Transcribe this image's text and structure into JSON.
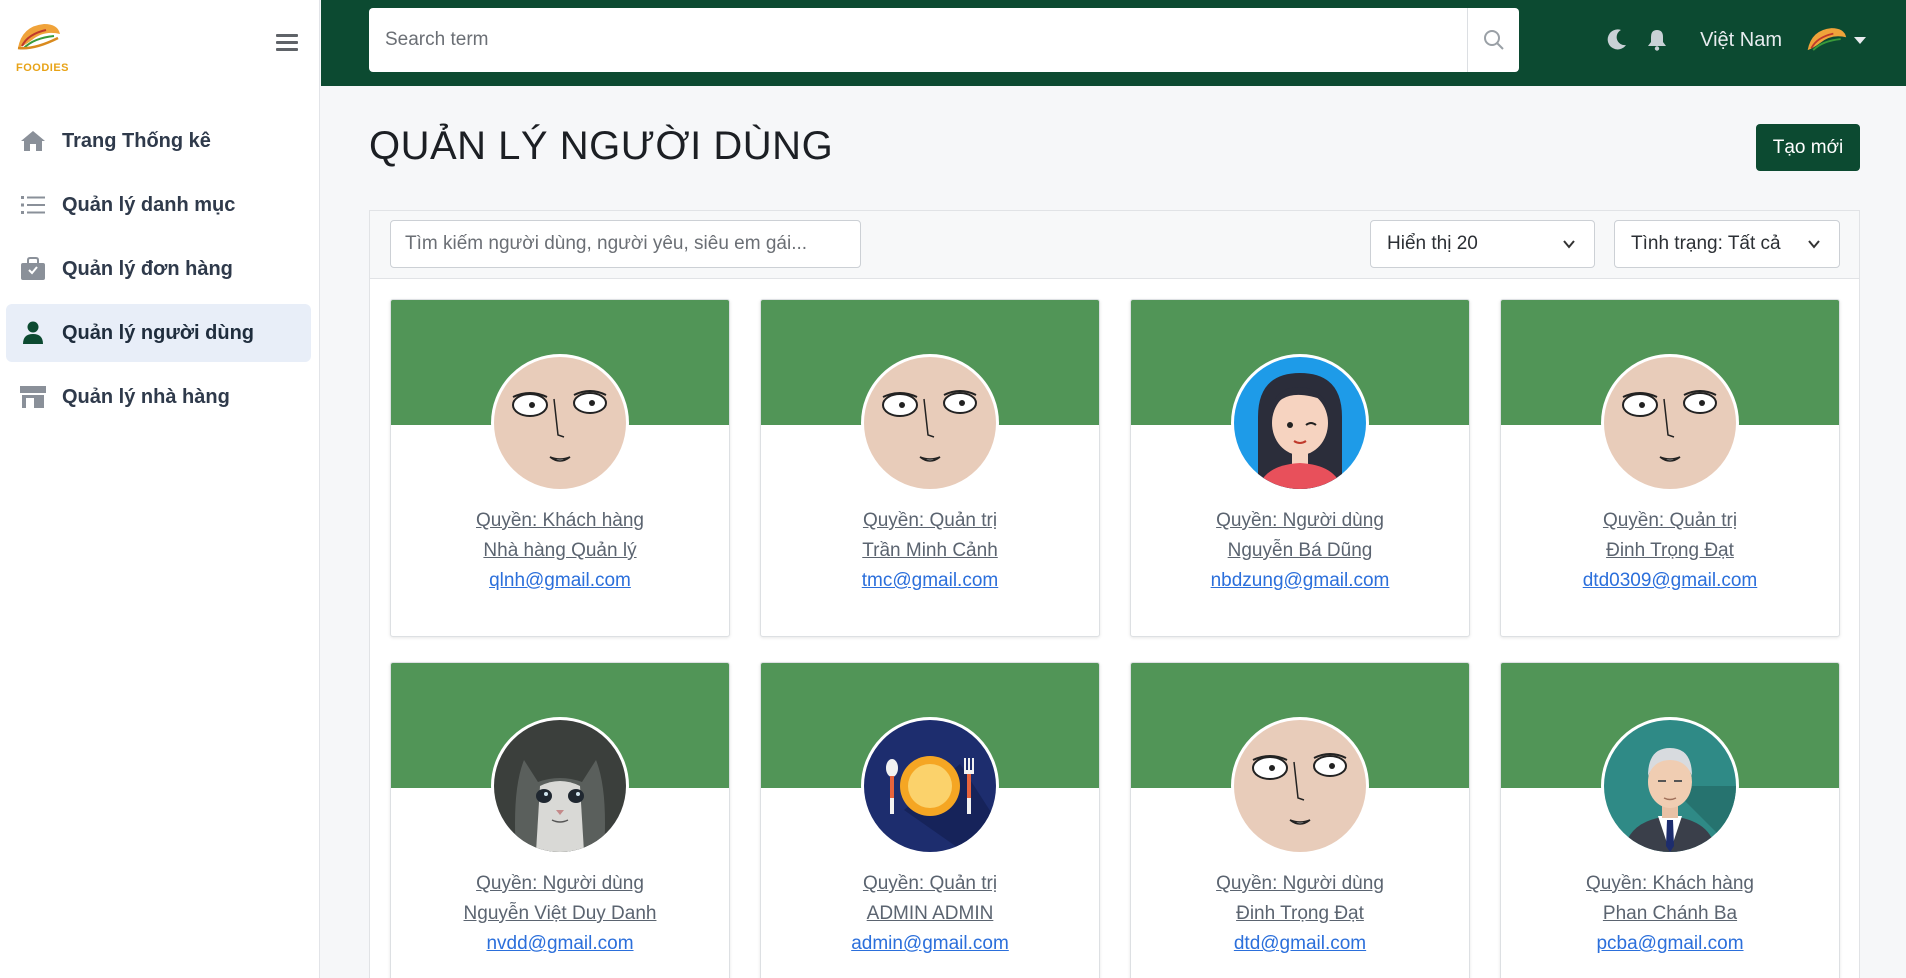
{
  "brand": {
    "name": "FOODIES"
  },
  "sidebar": {
    "items": [
      {
        "label": "Trang Thống kê",
        "icon": "home-icon",
        "active": false
      },
      {
        "label": "Quản lý danh mục",
        "icon": "list-icon",
        "active": false
      },
      {
        "label": "Quản lý đơn hàng",
        "icon": "shopping-bag-icon",
        "active": false
      },
      {
        "label": "Quản lý người dùng",
        "icon": "user-icon",
        "active": true
      },
      {
        "label": "Quản lý nhà hàng",
        "icon": "store-icon",
        "active": false
      }
    ]
  },
  "topbar": {
    "search_placeholder": "Search term",
    "language": "Việt Nam",
    "icons": [
      "moon-icon",
      "bell-icon",
      "search-icon"
    ]
  },
  "main": {
    "title": "QUẢN LÝ NGƯỜI DÙNG",
    "create_label": "Tạo mới",
    "filter_placeholder": "Tìm kiếm người dùng, người yêu, siêu em gái...",
    "page_size_label": "Hiển thị 20",
    "status_label": "Tình trạng: Tất cả"
  },
  "users": [
    {
      "role": "Quyền: Khách hàng",
      "name": "Nhà hàng Quản lý",
      "email": "qlnh@gmail.com",
      "avatar": "bald-face"
    },
    {
      "role": "Quyền: Quản trị",
      "name": "Trần Minh Cảnh",
      "email": "tmc@gmail.com",
      "avatar": "bald-face"
    },
    {
      "role": "Quyền: Người dùng",
      "name": "Nguyễn Bá Dũng",
      "email": "nbdzung@gmail.com",
      "avatar": "girl"
    },
    {
      "role": "Quyền: Quản trị",
      "name": "Đinh Trọng Đạt",
      "email": "dtd0309@gmail.com",
      "avatar": "bald-face"
    },
    {
      "role": "Quyền: Người dùng",
      "name": "Nguyễn Việt Duy Danh",
      "email": "nvdd@gmail.com",
      "avatar": "cat"
    },
    {
      "role": "Quyền: Quản trị",
      "name": "ADMIN ADMIN",
      "email": "admin@gmail.com",
      "avatar": "plate"
    },
    {
      "role": "Quyền: Người dùng",
      "name": "Đinh Trọng Đạt",
      "email": "dtd@gmail.com",
      "avatar": "bald-face"
    },
    {
      "role": "Quyền: Khách hàng",
      "name": "Phan Chánh Ba",
      "email": "pcba@gmail.com",
      "avatar": "old-man"
    }
  ],
  "colors": {
    "primary": "#0c4a31",
    "banner": "#519557",
    "link": "#2b6fdb"
  }
}
